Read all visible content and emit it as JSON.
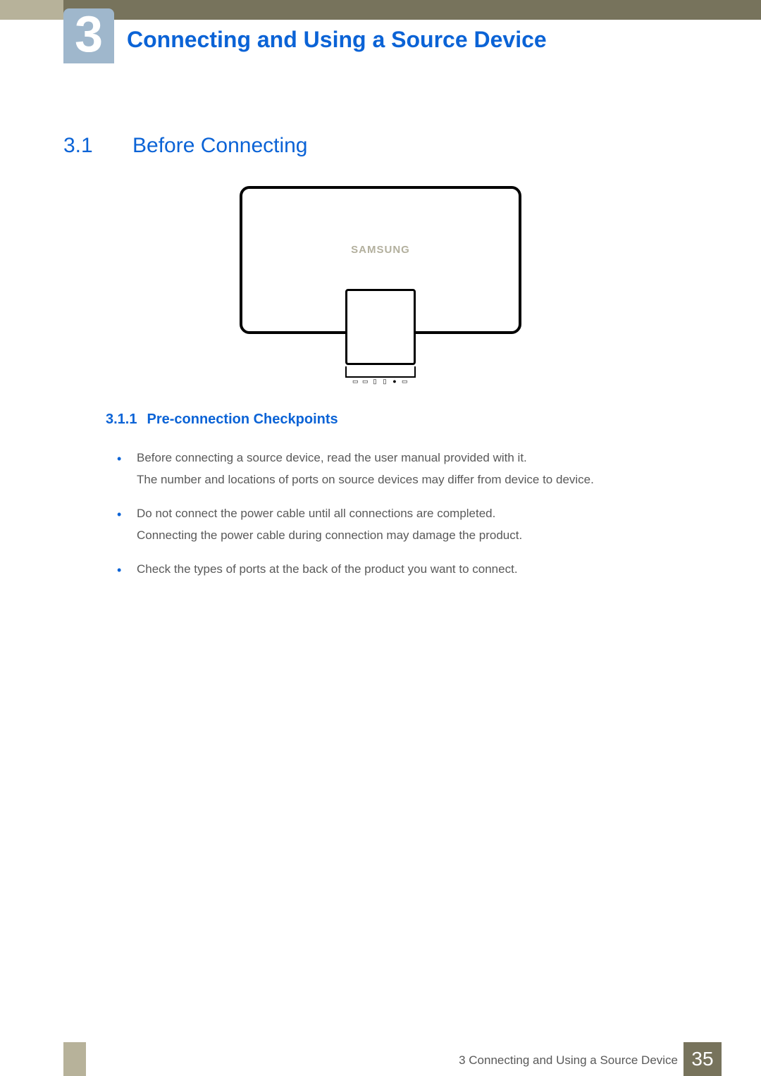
{
  "chapter": {
    "number": "3",
    "title": "Connecting and Using a Source Device"
  },
  "section": {
    "number": "3.1",
    "title": "Before Connecting"
  },
  "illustration": {
    "brand": "SAMSUNG"
  },
  "subsection": {
    "number": "3.1.1",
    "title": "Pre-connection Checkpoints"
  },
  "bullets": [
    {
      "line1": "Before connecting a source device, read the user manual provided with it.",
      "line2": "The number and locations of ports on source devices may differ from device to device."
    },
    {
      "line1": "Do not connect the power cable until all connections are completed.",
      "line2": "Connecting the power cable during connection may damage the product."
    },
    {
      "line1": "Check the types of ports at the back of the product you want to connect.",
      "line2": ""
    }
  ],
  "footer": {
    "breadcrumb": "3 Connecting and Using a Source Device",
    "page": "35"
  }
}
